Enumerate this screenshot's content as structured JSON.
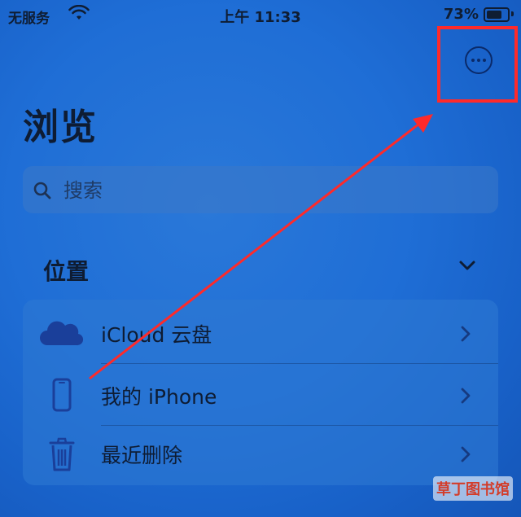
{
  "status_bar": {
    "carrier": "无服务",
    "time": "上午 11:33",
    "battery_percent": "73%",
    "battery_level": 0.73
  },
  "header": {
    "more_icon": "ellipsis-circle-icon",
    "title": "浏览"
  },
  "search": {
    "placeholder": "搜索",
    "icon": "search-icon"
  },
  "locations": {
    "title": "位置",
    "items": [
      {
        "label": "iCloud 云盘",
        "icon": "cloud-icon"
      },
      {
        "label": "我的 iPhone",
        "icon": "iphone-icon"
      },
      {
        "label": "最近删除",
        "icon": "trash-icon"
      }
    ]
  },
  "annotation": {
    "highlight_color": "#ff2a2a",
    "arrow_color": "#ff2a2a"
  },
  "watermark": "草丁图书馆",
  "colors": {
    "background": "#1f6ed6",
    "text": "#0e1c33"
  }
}
